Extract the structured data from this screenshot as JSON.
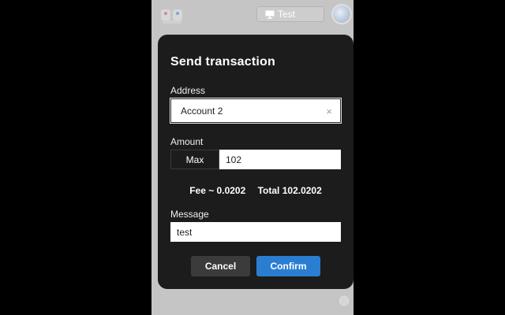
{
  "header": {
    "network_label": "Test",
    "network_icon": "monitor-icon",
    "logo_icon": "app-logo-icon",
    "avatar_icon": "account-avatar-icon"
  },
  "modal": {
    "title": "Send transaction",
    "address": {
      "label": "Address",
      "value": "Account 2",
      "clear_icon": "×"
    },
    "amount": {
      "label": "Amount",
      "max_label": "Max",
      "value": "102"
    },
    "fee_text": "Fee ~ 0.0202",
    "total_text": "Total 102.0202",
    "message": {
      "label": "Message",
      "value": "test"
    },
    "buttons": {
      "cancel": "Cancel",
      "confirm": "Confirm"
    }
  },
  "footer": {
    "settings_icon": "settings-icon"
  },
  "colors": {
    "modal_bg": "#1c1c1c",
    "confirm": "#2a7ed2",
    "cancel": "#3b3b3b",
    "backdrop": "#c5c5c5"
  }
}
